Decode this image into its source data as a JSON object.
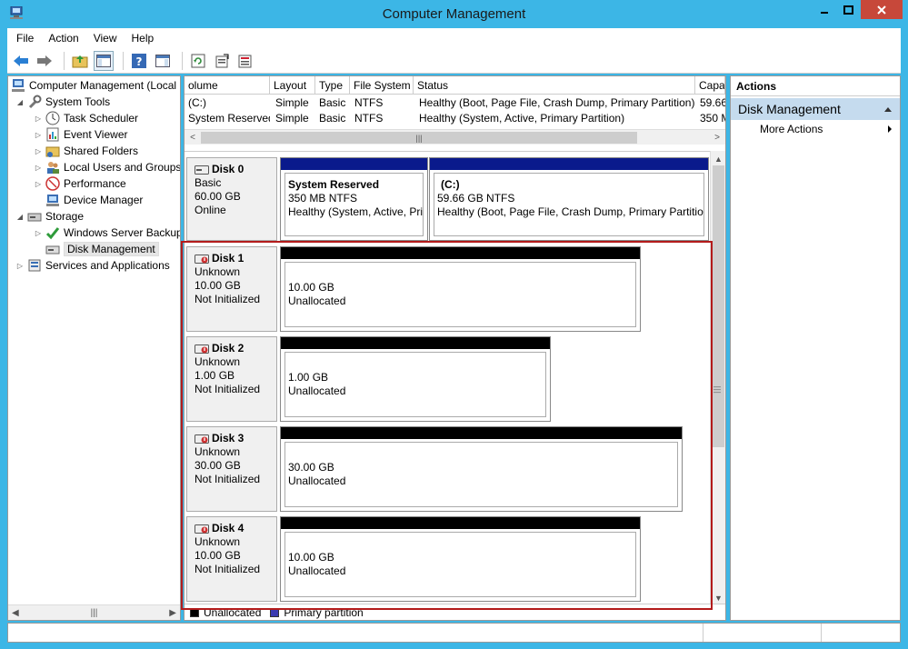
{
  "window": {
    "title": "Computer Management"
  },
  "menu": [
    "File",
    "Action",
    "View",
    "Help"
  ],
  "tree": {
    "root": "Computer Management (Local",
    "system_tools": "System Tools",
    "items_system": [
      "Task Scheduler",
      "Event Viewer",
      "Shared Folders",
      "Local Users and Groups",
      "Performance",
      "Device Manager"
    ],
    "storage": "Storage",
    "items_storage": [
      "Windows Server Backup",
      "Disk Management"
    ],
    "services": "Services and Applications"
  },
  "volume_table": {
    "headers": [
      "olume",
      "Layout",
      "Type",
      "File System",
      "Status",
      "Capa"
    ],
    "rows": [
      [
        "(C:)",
        "Simple",
        "Basic",
        "NTFS",
        "Healthy (Boot, Page File, Crash Dump, Primary Partition)",
        "59.66"
      ],
      [
        "System Reserved",
        "Simple",
        "Basic",
        "NTFS",
        "Healthy (System, Active, Primary Partition)",
        "350 M"
      ]
    ]
  },
  "disks": [
    {
      "name": "Disk 0",
      "type": "Basic",
      "size": "60.00 GB",
      "status": "Online",
      "partitions": [
        {
          "name": "System Reserved",
          "size": "350 MB NTFS",
          "status": "Healthy (System, Active, Pri"
        },
        {
          "name": "(C:)",
          "size": "59.66 GB NTFS",
          "status": "Healthy (Boot, Page File, Crash Dump, Primary Partition"
        }
      ]
    },
    {
      "name": "Disk 1",
      "type": "Unknown",
      "size": "10.00 GB",
      "status": "Not Initialized",
      "part_size": "10.00 GB",
      "part_label": "Unallocated"
    },
    {
      "name": "Disk 2",
      "type": "Unknown",
      "size": "1.00 GB",
      "status": "Not Initialized",
      "part_size": "1.00 GB",
      "part_label": "Unallocated"
    },
    {
      "name": "Disk 3",
      "type": "Unknown",
      "size": "30.00 GB",
      "status": "Not Initialized",
      "part_size": "30.00 GB",
      "part_label": "Unallocated"
    },
    {
      "name": "Disk 4",
      "type": "Unknown",
      "size": "10.00 GB",
      "status": "Not Initialized",
      "part_size": "10.00 GB",
      "part_label": "Unallocated"
    }
  ],
  "legend": {
    "unallocated": "Unallocated",
    "primary": "Primary partition"
  },
  "actions": {
    "header": "Actions",
    "section": "Disk Management",
    "more": "More Actions"
  },
  "colors": {
    "primary_bar": "#0a1a8c",
    "unallocated_bar": "#000000",
    "highlight": "#b31b1b",
    "section_bg": "#c5dbee"
  }
}
